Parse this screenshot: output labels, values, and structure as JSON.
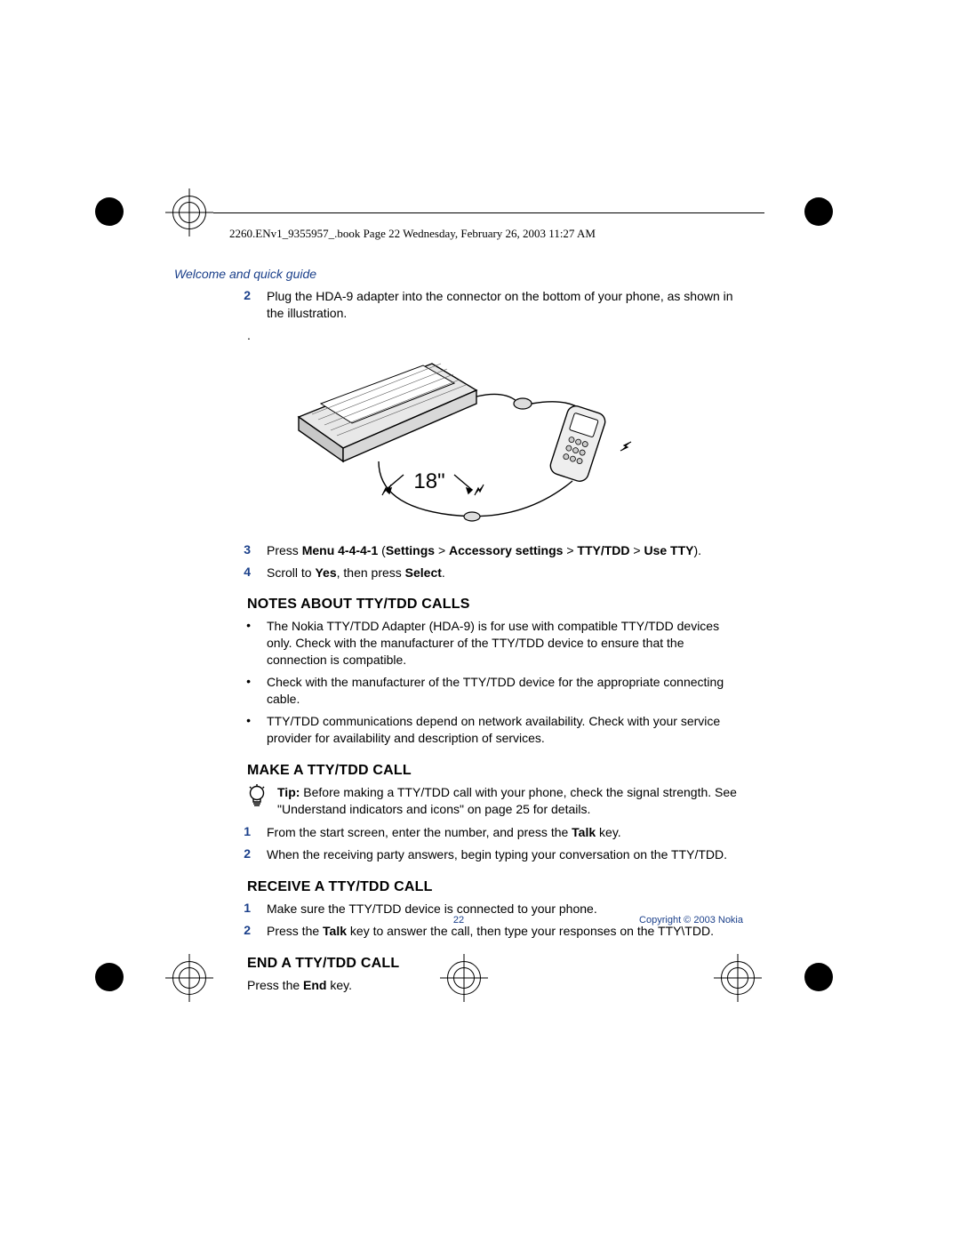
{
  "header": {
    "line": "2260.ENv1_9355957_.book  Page 22  Wednesday, February 26, 2003  11:27 AM"
  },
  "section_header": "Welcome and quick guide",
  "step2": {
    "num": "2",
    "text": "Plug the HDA-9 adapter into the connector on the bottom of your phone, as shown in the illustration."
  },
  "illustration_label": "18\"",
  "step3": {
    "num": "3",
    "prefix": "Press ",
    "bold1": "Menu 4-4-4-1",
    "mid1": " (",
    "bold2": "Settings",
    "mid2": " > ",
    "bold3": "Accessory settings",
    "mid3": " > ",
    "bold4": "TTY/TDD",
    "mid4": " > ",
    "bold5": "Use TTY",
    "suffix": ")."
  },
  "step4": {
    "num": "4",
    "prefix": "Scroll to ",
    "bold1": "Yes",
    "mid1": ", then press ",
    "bold2": "Select",
    "suffix": "."
  },
  "notes_heading": "NOTES ABOUT TTY/TDD CALLS",
  "notes": {
    "b1": "The Nokia TTY/TDD Adapter (HDA-9) is for use with compatible TTY/TDD devices only. Check with the manufacturer of the TTY/TDD device to ensure that the connection is compatible.",
    "b2": "Check with the manufacturer of the TTY/TDD device for the appropriate connecting cable.",
    "b3": "TTY/TDD communications depend on network availability. Check with your service provider for availability and description of services."
  },
  "make_heading": "MAKE A TTY/TDD CALL",
  "tip": {
    "label": "Tip:",
    "text": " Before making a TTY/TDD call with your phone, check the signal strength. See \"Understand indicators and icons\" on page 25 for details."
  },
  "make_steps": {
    "s1_num": "1",
    "s1_prefix": "From the start screen, enter the number, and press the ",
    "s1_bold": "Talk",
    "s1_suffix": " key.",
    "s2_num": "2",
    "s2_text": "When the receiving party answers, begin typing your conversation on the TTY/TDD."
  },
  "receive_heading": "RECEIVE A TTY/TDD CALL",
  "receive_steps": {
    "s1_num": "1",
    "s1_text": "Make sure the TTY/TDD device is connected to your phone.",
    "s2_num": "2",
    "s2_prefix": "Press the ",
    "s2_bold": "Talk",
    "s2_suffix": " key to answer the call, then type your responses on the TTY\\TDD."
  },
  "end_heading": "END A TTY/TDD CALL",
  "end_text_prefix": "Press the ",
  "end_text_bold": "End",
  "end_text_suffix": " key.",
  "footer": {
    "page": "22",
    "copyright": "Copyright ©  2003 Nokia"
  }
}
